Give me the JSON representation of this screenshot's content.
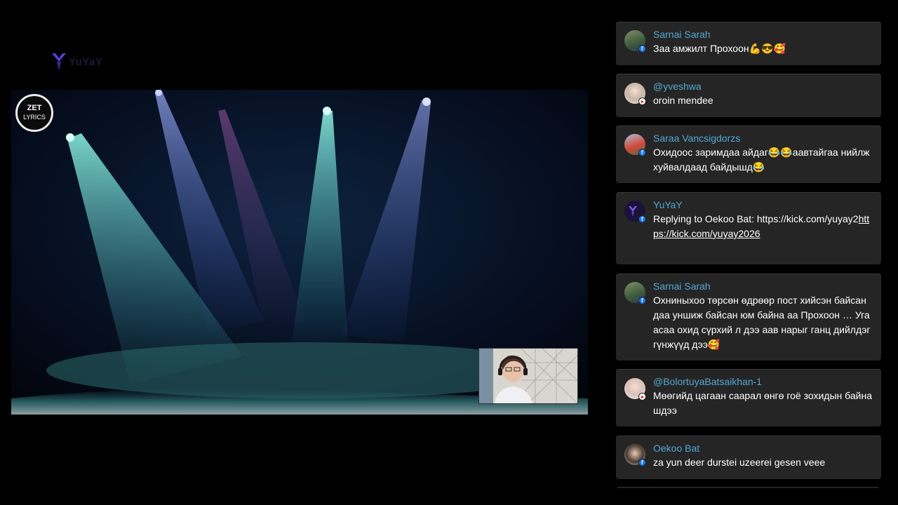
{
  "logo": {
    "text": "YuYaY"
  },
  "video": {
    "badge": {
      "line1": "ZET",
      "line2": "LYRICS"
    }
  },
  "chat": {
    "messages": [
      {
        "author": "Sarnai Sarah",
        "platform": "facebook",
        "text": "Заа амжилт Прохоон💪😎🥰"
      },
      {
        "author": "@yveshwa",
        "platform": "youtube",
        "text": "oroin mendee"
      },
      {
        "author": "Saraa Vancsigdorzs",
        "platform": "facebook",
        "text": "Охидоос заримдаа айдаг😂😂аавтайгаа нийлж хуйвалдаад байдышд😂"
      },
      {
        "author": "YuYaY",
        "platform": "facebook",
        "text_prefix": "Replying to Oekoo Bat: https://kick.com/yuyay2",
        "link": "https://kick.com/yuyay2026"
      },
      {
        "author": "Sarnai Sarah",
        "platform": "facebook",
        "text": "Охниныхоо төрсөн өдрөөр пост хийсэн байсан даа уншиж байсан юм байна аа Прохоон … Угаасаа охид сүрхий л дээ аав нарыг ганц дийлдэг гүнжүүд дээ🥰"
      },
      {
        "author": "@BolortuyaBatsaikhan-1",
        "platform": "youtube",
        "text": "Мөөгийд цагаан саарал өнгө гоё зохидын байнашдээ"
      },
      {
        "author": "Oekoo Bat",
        "platform": "facebook",
        "text": "za yun deer durstei uzeerei gesen veee"
      }
    ]
  },
  "colors": {
    "author": "#52a9d4",
    "card": "#252525",
    "facebook": "#1877f2",
    "youtube": "#e00000"
  }
}
